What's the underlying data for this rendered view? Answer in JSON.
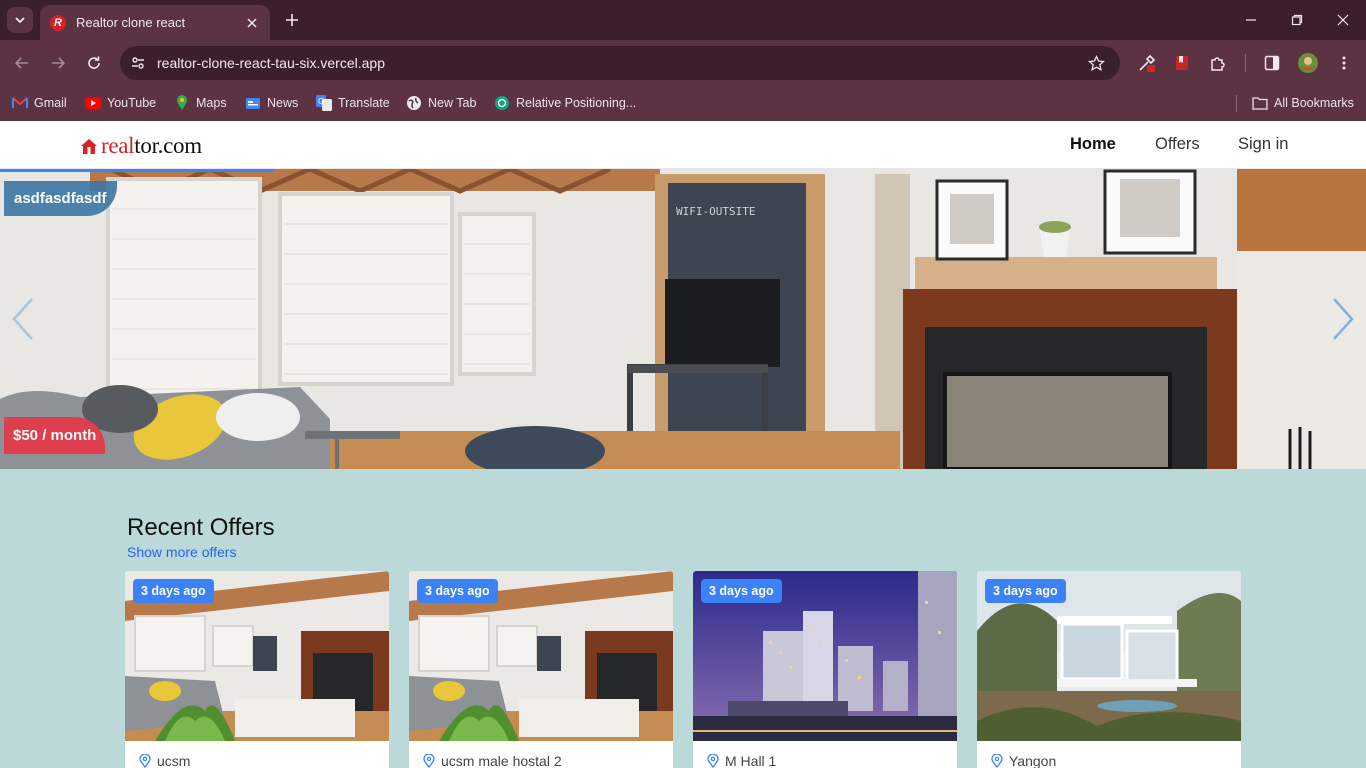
{
  "browser": {
    "tab_title": "Realtor clone react",
    "url": "realtor-clone-react-tau-six.vercel.app",
    "bookmarks": [
      {
        "label": "Gmail",
        "icon": "gmail-icon"
      },
      {
        "label": "YouTube",
        "icon": "youtube-icon"
      },
      {
        "label": "Maps",
        "icon": "maps-icon"
      },
      {
        "label": "News",
        "icon": "news-icon"
      },
      {
        "label": "Translate",
        "icon": "translate-icon"
      },
      {
        "label": "New Tab",
        "icon": "globe-icon"
      },
      {
        "label": "Relative Positioning...",
        "icon": "chatgpt-icon"
      }
    ],
    "all_bookmarks": "All Bookmarks"
  },
  "site": {
    "logo": {
      "part_red": "real",
      "part_dark": "tor.com"
    },
    "nav": {
      "home": "Home",
      "offers": "Offers",
      "sign_in": "Sign in"
    },
    "slider": {
      "name": "asdfasdfasdf",
      "price": "$50 / month",
      "progress": 0.2
    }
  },
  "recent": {
    "title": "Recent Offers",
    "more": "Show more offers",
    "cards": [
      {
        "badge": "3 days ago",
        "location": "ucsm",
        "image": "living-room"
      },
      {
        "badge": "3 days ago",
        "location": "ucsm male hostal 2",
        "image": "living-room"
      },
      {
        "badge": "3 days ago",
        "location": "M Hall 1",
        "image": "towers-night"
      },
      {
        "badge": "3 days ago",
        "location": "Yangon",
        "image": "glass-house"
      }
    ]
  },
  "colors": {
    "chrome_dark": "#3b1f2b",
    "chrome": "#5b3343",
    "page_bg": "#bcd9d9",
    "accent_blue": "#3b82f6",
    "brand_red": "#d92228"
  }
}
